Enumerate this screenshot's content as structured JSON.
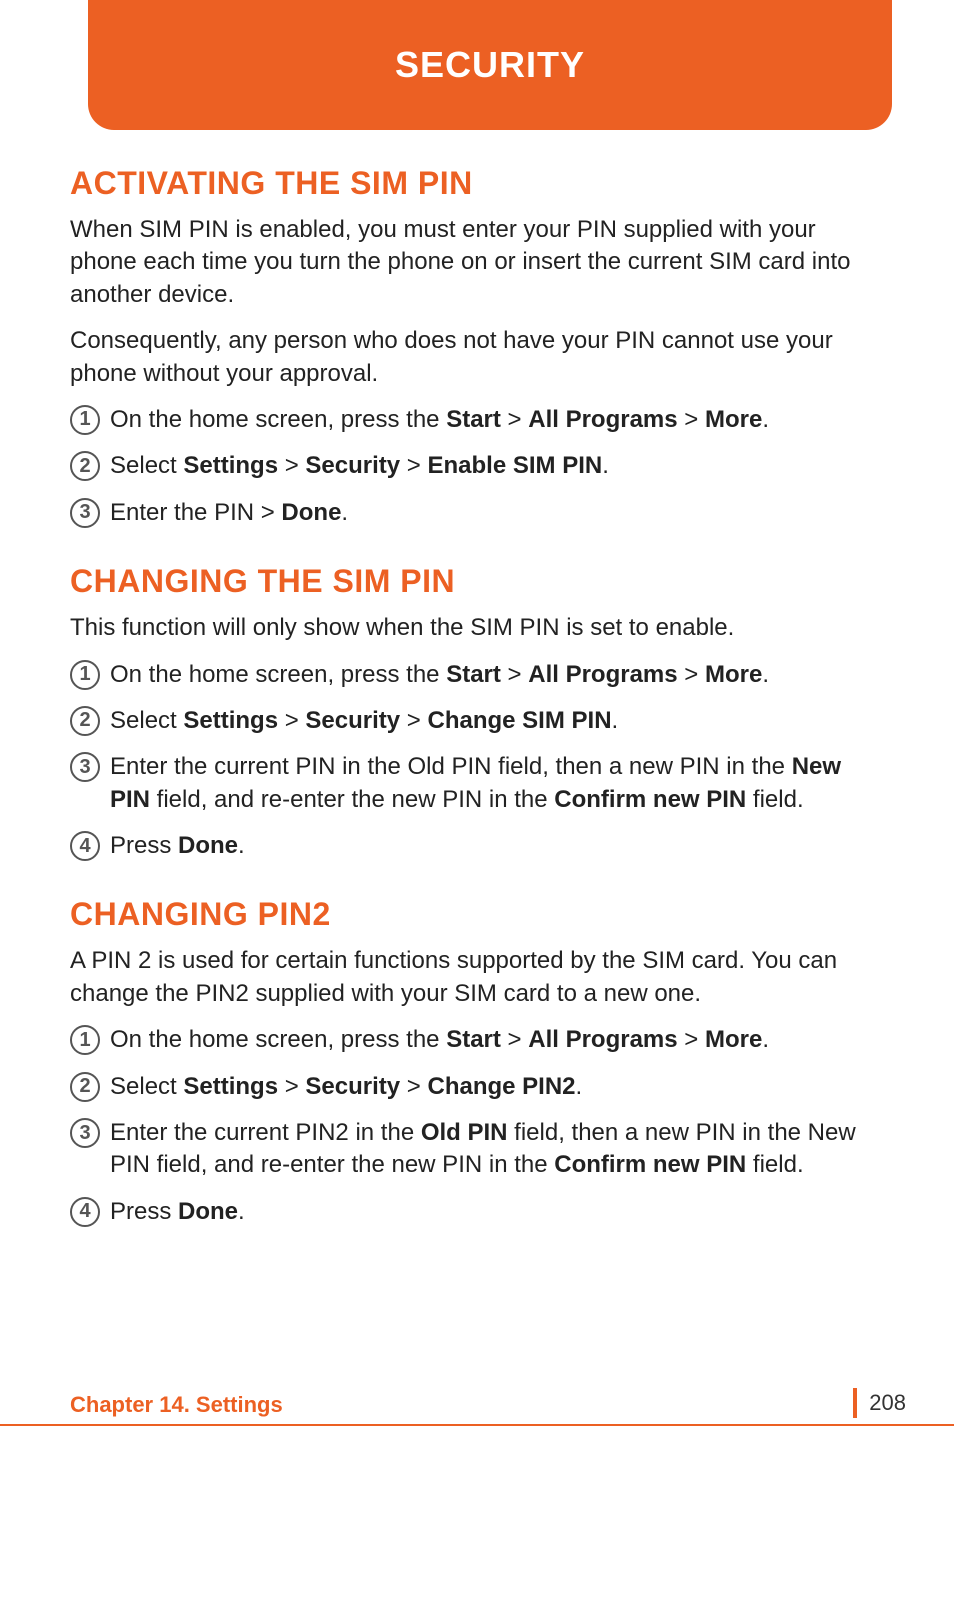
{
  "banner": {
    "title": "SECURITY"
  },
  "sections": [
    {
      "heading": "ACTIVATING THE SIM PIN",
      "intro": [
        "When SIM PIN is enabled, you must enter your PIN supplied with your phone each time you turn the phone on or insert the current SIM card into another device.",
        "Consequently, any person who does not have your PIN cannot use your phone without your approval."
      ],
      "steps": [
        "On the home screen, press the <b>Start</b> > <b>All Programs</b> > <b>More</b>.",
        "Select <b>Settings</b> > <b>Security</b> > <b>Enable SIM PIN</b>.",
        "Enter the PIN > <b>Done</b>."
      ]
    },
    {
      "heading": "CHANGING THE SIM PIN",
      "intro": [
        "This function will only show when the SIM PIN is set to enable."
      ],
      "steps": [
        "On the home screen, press the <b>Start</b> > <b>All Programs</b> > <b>More</b>.",
        "Select <b>Settings</b> > <b>Security</b> > <b>Change SIM PIN</b>.",
        "Enter the current PIN in the Old PIN field, then a new PIN in the <b>New PIN</b> field, and re-enter the new PIN in the <b>Confirm new PIN</b> field.",
        "Press <b>Done</b>."
      ]
    },
    {
      "heading": "CHANGING PIN2",
      "intro": [
        "A PIN 2 is used for certain functions supported by the SIM card. You can change the PIN2 supplied with your SIM card to a new one."
      ],
      "steps": [
        "On the home screen, press the <b>Start</b> > <b>All Programs</b> > <b>More</b>.",
        "Select <b>Settings</b> > <b>Security</b> > <b>Change PIN2</b>.",
        "Enter the current PIN2 in the <b>Old PIN</b> field, then a new PIN in the New PIN field, and re-enter the new PIN in the <b>Confirm new PIN</b> field.",
        "Press <b>Done</b>."
      ]
    }
  ],
  "footer": {
    "chapter": "Chapter 14. Settings",
    "page": "208"
  }
}
